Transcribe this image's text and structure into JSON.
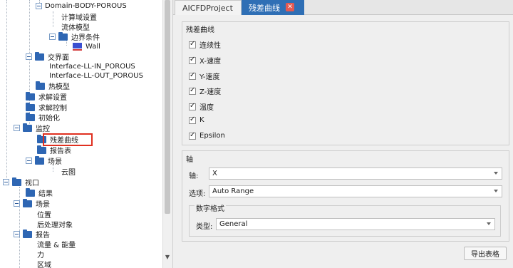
{
  "tree": {
    "domain_body": "Domain-BODY-POROUS",
    "calc_domain_settings": "计算域设置",
    "fluid_model": "流体模型",
    "boundary_conditions": "边界条件",
    "wall": "Wall",
    "interface": "交界面",
    "interface_in": "Interface-LL-IN_POROUS",
    "interface_out": "Interface-LL-OUT_POROUS",
    "thermal_model": "热模型",
    "solver_settings": "求解设置",
    "solver_control": "求解控制",
    "initialization": "初始化",
    "monitor": "监控",
    "residual_curve": "残差曲线",
    "report_table": "报告表",
    "scene": "场景",
    "contour": "云图",
    "view": "视口",
    "results": "结果",
    "scene2": "场景",
    "position": "位置",
    "postprocess_objects": "后处理对象",
    "report": "报告",
    "flux_energy": "流量 & 能量",
    "force": "力",
    "region": "区域"
  },
  "tabs": {
    "project": "AICFDProject",
    "residual": "残差曲线",
    "close": "✕"
  },
  "residual_group": {
    "title": "残差曲线",
    "items": [
      "连续性",
      "X-速度",
      "Y-速度",
      "Z-速度",
      "温度",
      "K",
      "Epsilon"
    ]
  },
  "axis_group": {
    "title": "轴",
    "axis_label": "轴:",
    "axis_value": "X",
    "option_label": "选项:",
    "option_value": "Auto Range",
    "number_format": {
      "title": "数字格式",
      "type_label": "类型:",
      "type_value": "General"
    }
  },
  "export_button": "导出表格"
}
